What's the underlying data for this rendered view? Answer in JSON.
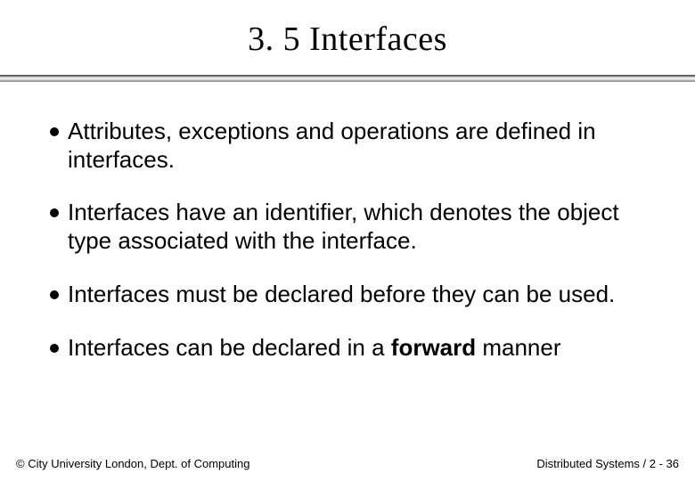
{
  "title": "3. 5 Interfaces",
  "bullets": [
    {
      "text": "Attributes, exceptions and operations are defined in interfaces."
    },
    {
      "text": "Interfaces have an identifier, which denotes the object type associated with the interface."
    },
    {
      "text": "Interfaces must be declared before they can be used."
    },
    {
      "pre": "Interfaces can be declared in a ",
      "bold": "forward",
      "post": " manner"
    }
  ],
  "footer": {
    "left": "© City University London, Dept. of Computing",
    "right": "Distributed Systems / 2 - 36"
  }
}
